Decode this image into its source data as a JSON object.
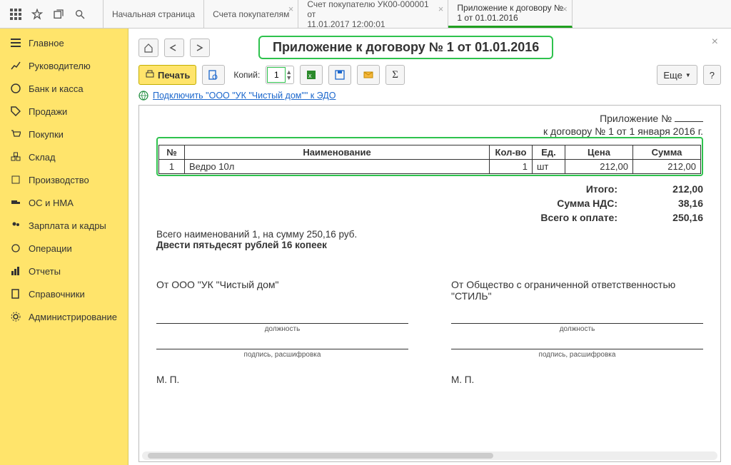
{
  "topbar": {
    "icons": [
      "apps",
      "star",
      "new-window",
      "search"
    ]
  },
  "tabs": [
    {
      "line1": "Начальная страница",
      "line2": "",
      "closable": false
    },
    {
      "line1": "Счета покупателям",
      "line2": "",
      "closable": true
    },
    {
      "line1": "Счет покупателю УК00-000001 от",
      "line2": "11.01.2017 12:00:01",
      "closable": true
    },
    {
      "line1": "Приложение к договору №",
      "line2": "1 от 01.01.2016",
      "closable": true,
      "active": true
    }
  ],
  "sidebar": {
    "items": [
      {
        "icon": "menu",
        "label": "Главное"
      },
      {
        "icon": "chart-up",
        "label": "Руководителю"
      },
      {
        "icon": "coin",
        "label": "Банк и касса"
      },
      {
        "icon": "tag",
        "label": "Продажи"
      },
      {
        "icon": "cart",
        "label": "Покупки"
      },
      {
        "icon": "boxes",
        "label": "Склад"
      },
      {
        "icon": "tools",
        "label": "Производство"
      },
      {
        "icon": "truck",
        "label": "ОС и НМА"
      },
      {
        "icon": "people",
        "label": "Зарплата и кадры"
      },
      {
        "icon": "cycle",
        "label": "Операции"
      },
      {
        "icon": "bars",
        "label": "Отчеты"
      },
      {
        "icon": "book",
        "label": "Справочники"
      },
      {
        "icon": "gear",
        "label": "Администрирование"
      }
    ]
  },
  "header": {
    "title": "Приложение к договору № 1 от 01.01.2016"
  },
  "toolbar": {
    "print": "Печать",
    "copies_label": "Копий:",
    "copies_value": "1",
    "more": "Еще"
  },
  "edo": {
    "link": "Подключить \"ООО \"УК \"Чистый дом\"\" к ЭДО"
  },
  "doc": {
    "appendix_prefix": "Приложение №",
    "contract_line": "к договору № 1 от 1 января 2016 г.",
    "table": {
      "headers": {
        "num": "№",
        "name": "Наименование",
        "qty": "Кол-во",
        "unit": "Ед.",
        "price": "Цена",
        "sum": "Сумма"
      },
      "rows": [
        {
          "num": "1",
          "name": "Ведро 10л",
          "qty": "1",
          "unit": "шт",
          "price": "212,00",
          "sum": "212,00"
        }
      ]
    },
    "totals": {
      "itogo_lbl": "Итого:",
      "itogo_val": "212,00",
      "nds_lbl": "Сумма НДС:",
      "nds_val": "38,16",
      "total_lbl": "Всего к оплате:",
      "total_val": "250,16"
    },
    "sum_text_1": "Всего наименований 1, на сумму 250,16 руб.",
    "sum_text_2": "Двести пятьдесят рублей 16 копеек",
    "sign": {
      "left_from": "От ООО \"УК \"Чистый дом\"",
      "right_from": "От Общество с ограниченной ответственностью \"СТИЛЬ\"",
      "position": "должность",
      "sig": "подпись, расшифровка",
      "mp": "М. П."
    }
  }
}
